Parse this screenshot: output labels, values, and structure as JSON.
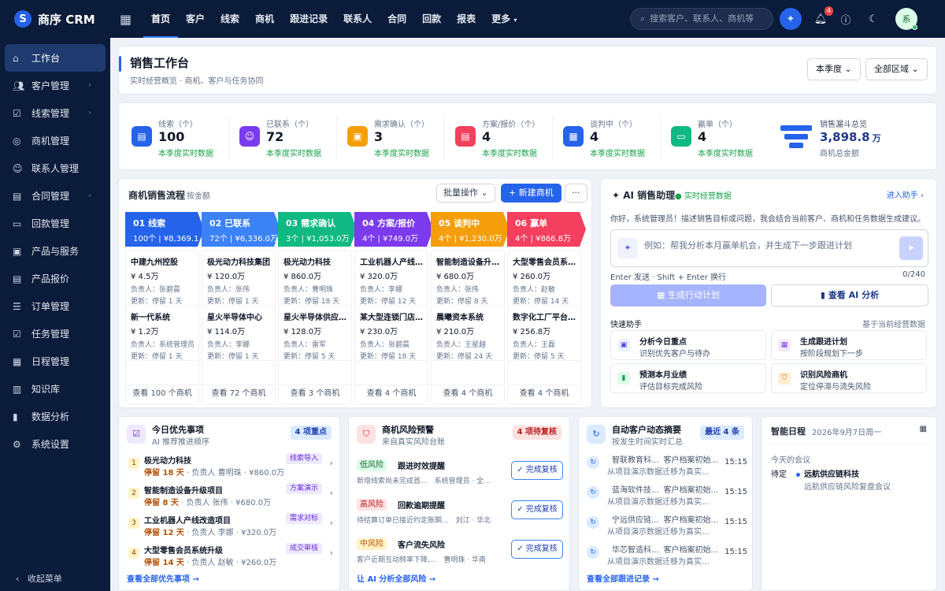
{
  "app": {
    "name": "商序 CRM"
  },
  "topnav": [
    "首页",
    "客户",
    "线索",
    "商机",
    "跟进记录",
    "联系人",
    "合同",
    "回款",
    "报表",
    "更多"
  ],
  "search_placeholder": "搜索客户、联系人、商机等",
  "notifications": "4",
  "user_initial": "系",
  "sidebar": [
    "工作台",
    "客户管理",
    "线索管理",
    "商机管理",
    "联系人管理",
    "合同管理",
    "回款管理",
    "产品与服务",
    "产品报价",
    "订单管理",
    "任务管理",
    "日程管理",
    "知识库",
    "数据分析",
    "系统设置"
  ],
  "collapse_label": "收起菜单",
  "page": {
    "title": "销售工作台",
    "subtitle": "实时经营概览 · 商机、客户与任务协同",
    "period": "本季度",
    "region": "全部区域"
  },
  "stats": [
    {
      "label": "线索（个）",
      "value": "100",
      "sub": "本季度实时数据",
      "color": "#2563eb"
    },
    {
      "label": "已联系（个）",
      "value": "72",
      "sub": "本季度实时数据",
      "color": "#7c3aed"
    },
    {
      "label": "需求确认（个）",
      "value": "3",
      "sub": "本季度实时数据",
      "color": "#f59e0b"
    },
    {
      "label": "方案/报价（个）",
      "value": "4",
      "sub": "本季度实时数据",
      "color": "#f43f5e"
    },
    {
      "label": "谈判中（个）",
      "value": "4",
      "sub": "本季度实时数据",
      "color": "#2563eb"
    },
    {
      "label": "赢单（个）",
      "value": "4",
      "sub": "本季度实时数据",
      "color": "#10b981"
    }
  ],
  "funnel": {
    "label": "销售漏斗总览",
    "value": "3,898.8",
    "unit": "万",
    "sub": "商机总金额"
  },
  "pipeline": {
    "title": "商机销售流程",
    "sub": "按金额",
    "batch": "批量操作",
    "new": "+ 新建商机",
    "more_btn": "···",
    "stages": [
      {
        "name": "01 线索",
        "summary": "100个 | ¥8,369.1万",
        "color": "#2563eb",
        "more": "查看 100 个商机",
        "items": [
          {
            "name": "中建九州控股",
            "amount": "¥ 4.5万",
            "owner": "负责人：张碧晨",
            "update": "更新：停留 1 天"
          },
          {
            "name": "新一代系统",
            "amount": "¥ 1.2万",
            "owner": "负责人：系统管理员",
            "update": "更新：停留 1 天"
          }
        ]
      },
      {
        "name": "02 已联系",
        "summary": "72个 | ¥6,336.0万",
        "color": "#3b82f6",
        "more": "查看 72 个商机",
        "items": [
          {
            "name": "极光动力科技集团",
            "amount": "¥ 120.0万",
            "owner": "负责人：张伟",
            "update": "更新：停留 1 天"
          },
          {
            "name": "星火半导体中心",
            "amount": "¥ 114.0万",
            "owner": "负责人：李娜",
            "update": "更新：停留 1 天"
          }
        ]
      },
      {
        "name": "03 需求确认",
        "summary": "3个 | ¥1,053.0万",
        "color": "#10b981",
        "more": "查看 3 个商机",
        "items": [
          {
            "name": "极光动力科技",
            "amount": "¥ 860.0万",
            "owner": "负责人：曹明珠",
            "update": "更新：停留 18 天"
          },
          {
            "name": "星火半导体供应...",
            "amount": "¥ 128.0万",
            "owner": "负责人：雷军",
            "update": "更新：停留 5 天"
          }
        ]
      },
      {
        "name": "04 方案/报价",
        "summary": "4个 | ¥749.0万",
        "color": "#7c3aed",
        "more": "查看 4 个商机",
        "items": [
          {
            "name": "工业机器人产线...",
            "amount": "¥ 320.0万",
            "owner": "负责人：李娜",
            "update": "更新：停留 12 天"
          },
          {
            "name": "某大型连锁门店...",
            "amount": "¥ 230.0万",
            "owner": "负责人：张碧晨",
            "update": "更新：停留 18 天"
          }
        ]
      },
      {
        "name": "05 谈判中",
        "summary": "4个 | ¥1,230.0万",
        "color": "#f59e0b",
        "more": "查看 4 个商机",
        "items": [
          {
            "name": "智能制造设备升...",
            "amount": "¥ 680.0万",
            "owner": "负责人：张伟",
            "update": "更新：停留 8 天"
          },
          {
            "name": "晨曦资本系统",
            "amount": "¥ 210.0万",
            "owner": "负责人：王星越",
            "update": "更新：停留 24 天"
          }
        ]
      },
      {
        "name": "06 赢单",
        "summary": "4个 | ¥866.8万",
        "color": "#f43f5e",
        "more": "查看 4 个商机",
        "items": [
          {
            "name": "大型零售会员系...",
            "amount": "¥ 260.0万",
            "owner": "负责人：赵敏",
            "update": "更新：停留 14 天"
          },
          {
            "name": "数字化工厂平台...",
            "amount": "¥ 256.8万",
            "owner": "负责人：王磊",
            "update": "更新：停留 5 天"
          }
        ]
      }
    ]
  },
  "ai": {
    "title": "AI 销售助理",
    "live": "实时经营数据",
    "enter": "进入助手",
    "intro": "你好，系统管理员！描述销售目标或问题，我会结合当前客户、商机和任务数据生成建议。",
    "placeholder": "例如：帮我分析本月赢单机会，并生成下一步跟进计划",
    "hint": "Enter 发送 · Shift + Enter 换行",
    "count": "0/240",
    "gen_btn": "生成行动计划",
    "view_btn": "查看 AI 分析",
    "quick_title": "快速助手",
    "quick_sub": "基于当前经营数据",
    "quick": [
      {
        "title": "分析今日重点",
        "desc": "识别优先客户与待办",
        "bg": "#eef2ff",
        "fg": "#4f46e5"
      },
      {
        "title": "生成跟进计划",
        "desc": "按阶段规划下一步",
        "bg": "#f3e8ff",
        "fg": "#7c3aed"
      },
      {
        "title": "预测本月业绩",
        "desc": "评估目标完成风险",
        "bg": "#dcfce7",
        "fg": "#16a34a"
      },
      {
        "title": "识别风险商机",
        "desc": "定位停滞与流失风险",
        "bg": "#ffedd5",
        "fg": "#ea580c"
      }
    ]
  },
  "priority": {
    "title": "今日优先事项",
    "sub": "AI 推荐推进顺序",
    "tag": "4 项重点",
    "foot": "查看全部优先事项 →",
    "items": [
      {
        "num": "1",
        "name": "极光动力科技",
        "stay": "停留 18 天",
        "detail": " · 负责人 曹明珠 · ¥860.0万",
        "tag": "线索导入"
      },
      {
        "num": "2",
        "name": "智能制造设备升级项目",
        "stay": "停留 8 天",
        "detail": " · 负责人 张伟 · ¥680.0万",
        "tag": "方案演示"
      },
      {
        "num": "3",
        "name": "工业机器人产线改造项目",
        "stay": "停留 12 天",
        "detail": " · 负责人 李娜 · ¥320.0万",
        "tag": "需求对标"
      },
      {
        "num": "4",
        "name": "大型零售会员系统升级",
        "stay": "停留 14 天",
        "detail": " · 负责人 赵敏 · ¥260.0万",
        "tag": "成交审核"
      }
    ]
  },
  "risk": {
    "title": "商机风险预警",
    "sub": "来自真实风险台账",
    "tag": "4 项待复核",
    "foot": "让 AI 分析全部风险 →",
    "done": "✓ 完成复核",
    "items": [
      {
        "level": "低风险",
        "title": "跟进时效提醒",
        "desc": "新增线索尚未完成首...　系统管理员 · 全...",
        "bg": "#dcfce7",
        "fg": "#166534"
      },
      {
        "level": "高风险",
        "title": "回款逾期提醒",
        "desc": "待结算订单已接近约定账期...　刘江 · 华北",
        "bg": "#fee2e2",
        "fg": "#b91c1c"
      },
      {
        "level": "中风险",
        "title": "客户流失风险",
        "desc": "客户近期互动频率下降,...　曹明珠 · 华南",
        "bg": "#fef3c7",
        "fg": "#b45309"
      }
    ]
  },
  "activity": {
    "title": "自动客户动态摘要",
    "sub": "按发生时间实时汇总",
    "tag": "最近 4 条",
    "foot": "查看全部跟进记录 →",
    "items": [
      {
        "name": "智联教育科...",
        "action": "客户档案初始...",
        "desc": "从项目演示数据迁移为真实...",
        "time": "15:15"
      },
      {
        "name": "蓝海软件技...",
        "action": "客户档案初始...",
        "desc": "从项目演示数据迁移为真实...",
        "time": "15:15"
      },
      {
        "name": "宁远供应链...",
        "action": "客户档案初始...",
        "desc": "从项目演示数据迁移为真实...",
        "time": "15:15"
      },
      {
        "name": "华芯智造科...",
        "action": "客户档案初始...",
        "desc": "从项目演示数据迁移为真实...",
        "time": "15:15"
      }
    ]
  },
  "schedule": {
    "title": "智能日程",
    "date": "2026年9月7日周一",
    "meetings_label": "今天的会议",
    "status": "待定",
    "meeting": "远航供应链科技",
    "meeting_desc": "远航供应链风险复盘会议"
  }
}
